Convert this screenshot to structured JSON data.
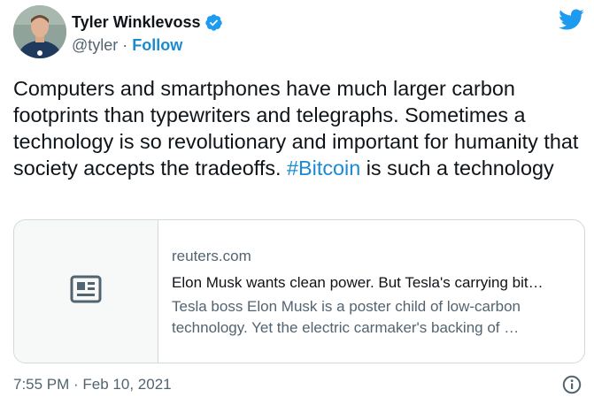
{
  "author": {
    "display_name": "Tyler Winklevoss",
    "handle": "@tyler",
    "separator": "·",
    "follow_label": "Follow",
    "verified": true
  },
  "tweet": {
    "text_before": "Computers and smartphones have much larger carbon footprints than typewriters and telegraphs. Sometimes a technology is so revolutionary and important for humanity that society accepts the tradeoffs. ",
    "hashtag": "#Bitcoin",
    "text_after": " is such a technology"
  },
  "card": {
    "domain": "reuters.com",
    "title": "Elon Musk wants clean power. But Tesla's carrying bit…",
    "description": "Tesla boss Elon Musk is a poster child of low-carbon technology. Yet the electric carmaker's backing of …",
    "media_icon": "news-article-icon"
  },
  "footer": {
    "timestamp": "7:55 PM · Feb 10, 2021"
  },
  "icons": {
    "brand": "twitter-bird-icon",
    "verified": "verified-badge-icon",
    "info": "info-icon"
  },
  "colors": {
    "accent": "#1b8ad1",
    "twitter_blue": "#1d9bf0",
    "text": "#0f1419",
    "secondary": "#536471",
    "border": "#cfd9de"
  }
}
